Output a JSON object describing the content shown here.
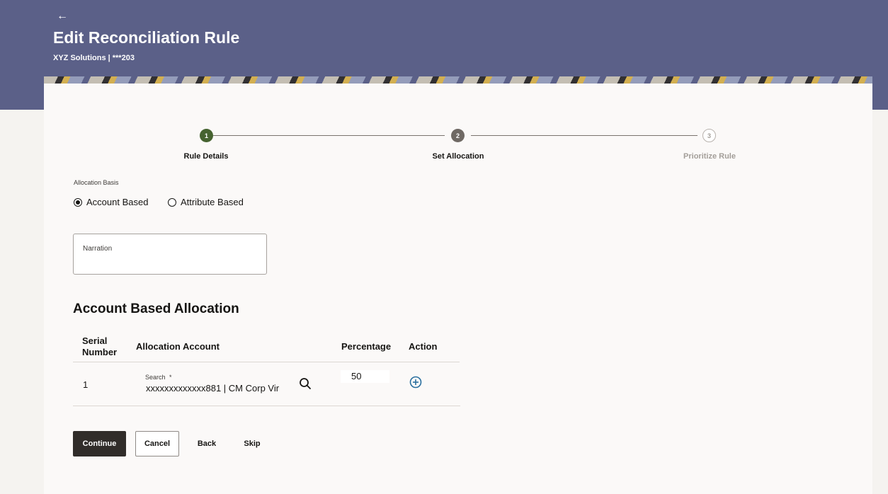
{
  "header": {
    "back_icon": "back-arrow-icon",
    "title": "Edit Reconciliation Rule",
    "subtitle": "XYZ Solutions | ***203",
    "colors": {
      "header_bg": "#5b6088"
    }
  },
  "stepper": {
    "steps": [
      {
        "number": "1",
        "label": "Rule Details",
        "state": "complete"
      },
      {
        "number": "2",
        "label": "Set Allocation",
        "state": "current"
      },
      {
        "number": "3",
        "label": "Prioritize Rule",
        "state": "pending"
      }
    ],
    "colors": {
      "complete": "#466330",
      "current": "#6f6964"
    }
  },
  "allocation_basis": {
    "label": "Allocation Basis",
    "options": [
      {
        "label": "Account Based",
        "selected": true
      },
      {
        "label": "Attribute Based",
        "selected": false
      }
    ]
  },
  "narration": {
    "label": "Narration",
    "value": ""
  },
  "section": {
    "title": "Account Based Allocation"
  },
  "table": {
    "headers": {
      "serial": "Serial Number",
      "serial_line1": "Serial",
      "serial_line2": "Number",
      "account": "Allocation Account",
      "percentage": "Percentage",
      "action": "Action"
    },
    "rows": [
      {
        "serial": "1",
        "search_label": "Search",
        "required_marker": "*",
        "account": "xxxxxxxxxxxxx881 | CM Corp Vir",
        "percentage": "50",
        "search_icon": "search-icon",
        "action_icon": "add-circle-icon"
      }
    ]
  },
  "actions": {
    "continue": "Continue",
    "cancel": "Cancel",
    "back": "Back",
    "skip": "Skip"
  }
}
